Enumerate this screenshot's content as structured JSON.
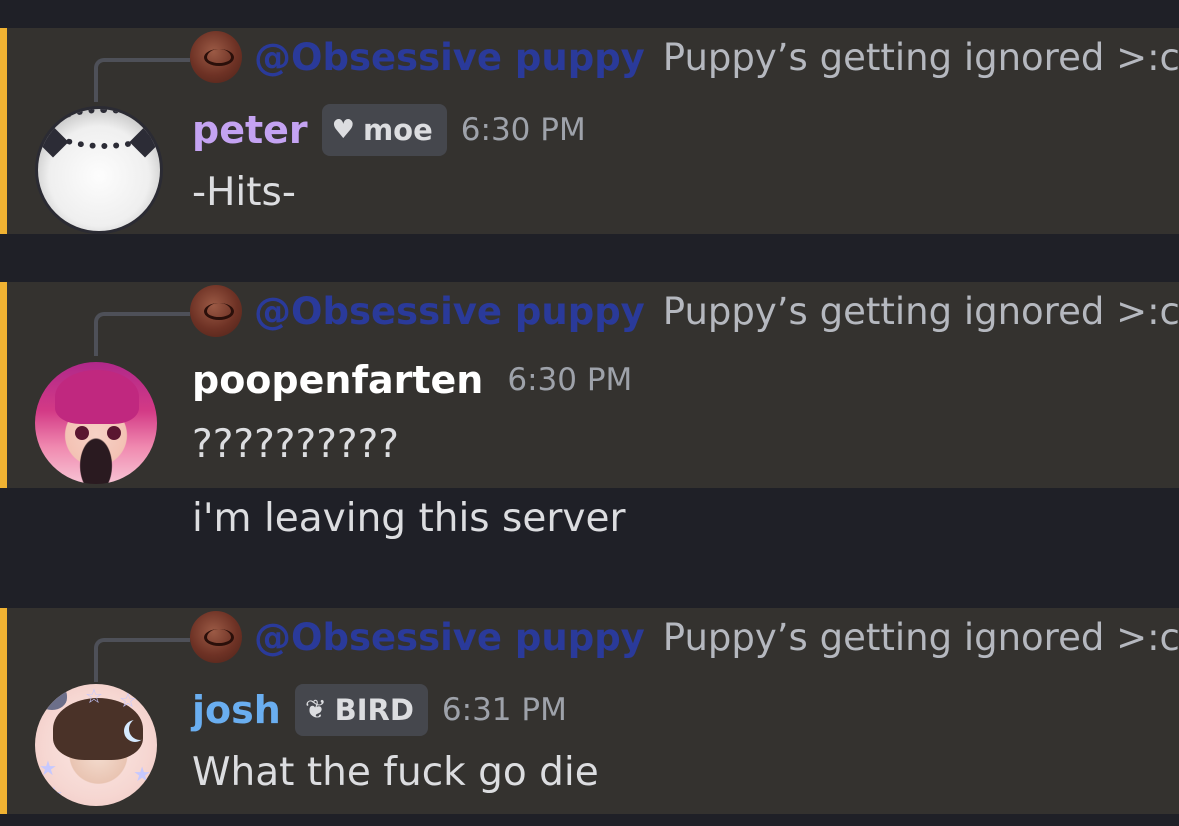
{
  "messages": [
    {
      "reply": {
        "mention": "@Obsessive puppy",
        "text": "Puppy’s getting ignored >:c"
      },
      "username": "peter",
      "tag": {
        "icon": "heart-icon",
        "label": "moe"
      },
      "time": "6:30 PM",
      "lines": [
        "-Hits-"
      ]
    },
    {
      "reply": {
        "mention": "@Obsessive puppy",
        "text": "Puppy’s getting ignored >:c"
      },
      "username": "poopenfarten",
      "time": "6:30 PM",
      "lines": [
        "??????????",
        "i'm leaving this server"
      ]
    },
    {
      "reply": {
        "mention": "@Obsessive puppy",
        "text": "Puppy’s getting ignored >:c"
      },
      "username": "josh",
      "tag": {
        "icon": "feather-icon",
        "label": "BIRD"
      },
      "time": "6:31 PM",
      "lines": [
        "What the fuck go die"
      ]
    }
  ],
  "colors": {
    "background": "#1f2027",
    "highlight": "#34322f",
    "highlight_bar": "#f0b232",
    "mention": "#2a3a9a",
    "peter": "#c4a3f2",
    "poopenfarten": "#ffffff",
    "josh": "#6aaef0"
  }
}
